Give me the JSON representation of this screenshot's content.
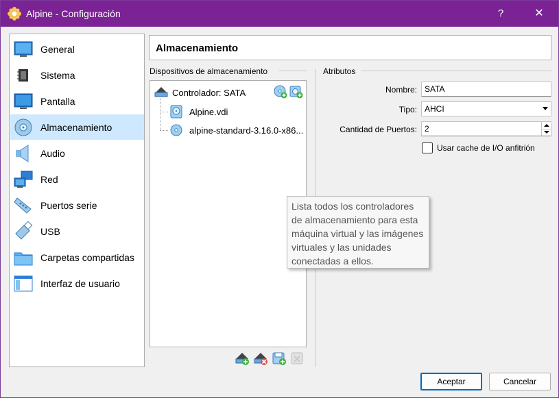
{
  "window": {
    "title": "Alpine - Configuración",
    "help_label": "?",
    "close_label": "✕"
  },
  "sidebar": {
    "items": [
      {
        "label": "General",
        "icon": "general-icon"
      },
      {
        "label": "Sistema",
        "icon": "system-icon"
      },
      {
        "label": "Pantalla",
        "icon": "display-icon"
      },
      {
        "label": "Almacenamiento",
        "icon": "storage-icon",
        "selected": true
      },
      {
        "label": "Audio",
        "icon": "audio-icon"
      },
      {
        "label": "Red",
        "icon": "network-icon"
      },
      {
        "label": "Puertos serie",
        "icon": "serial-ports-icon"
      },
      {
        "label": "USB",
        "icon": "usb-icon"
      },
      {
        "label": "Carpetas compartidas",
        "icon": "shared-folders-icon"
      },
      {
        "label": "Interfaz de usuario",
        "icon": "user-interface-icon"
      }
    ]
  },
  "page": {
    "title": "Almacenamiento"
  },
  "devices": {
    "group_label": "Dispositivos de almacenamiento",
    "controller": "Controlador: SATA",
    "items": [
      {
        "label": "Alpine.vdi",
        "icon": "hard-disk-icon"
      },
      {
        "label": "alpine-standard-3.16.0-x86...",
        "icon": "optical-disc-icon"
      }
    ]
  },
  "attributes": {
    "group_label": "Atributos",
    "name_label": "Nombre:",
    "name_value": "SATA",
    "type_label": "Tipo:",
    "type_value": "AHCI",
    "ports_label": "Cantidad de Puertos:",
    "ports_value": "2",
    "cache_label": "Usar cache de I/O anfitrión",
    "cache_checked": false
  },
  "tooltip": {
    "text": "Lista todos los controladores de almacenamiento para esta máquina virtual y las imágenes virtuales y las unidades conectadas a ellos."
  },
  "buttons": {
    "ok": "Aceptar",
    "cancel": "Cancelar"
  },
  "colors": {
    "titlebar": "#7b2394",
    "selection": "#cde8ff",
    "accent": "#0067c0"
  }
}
